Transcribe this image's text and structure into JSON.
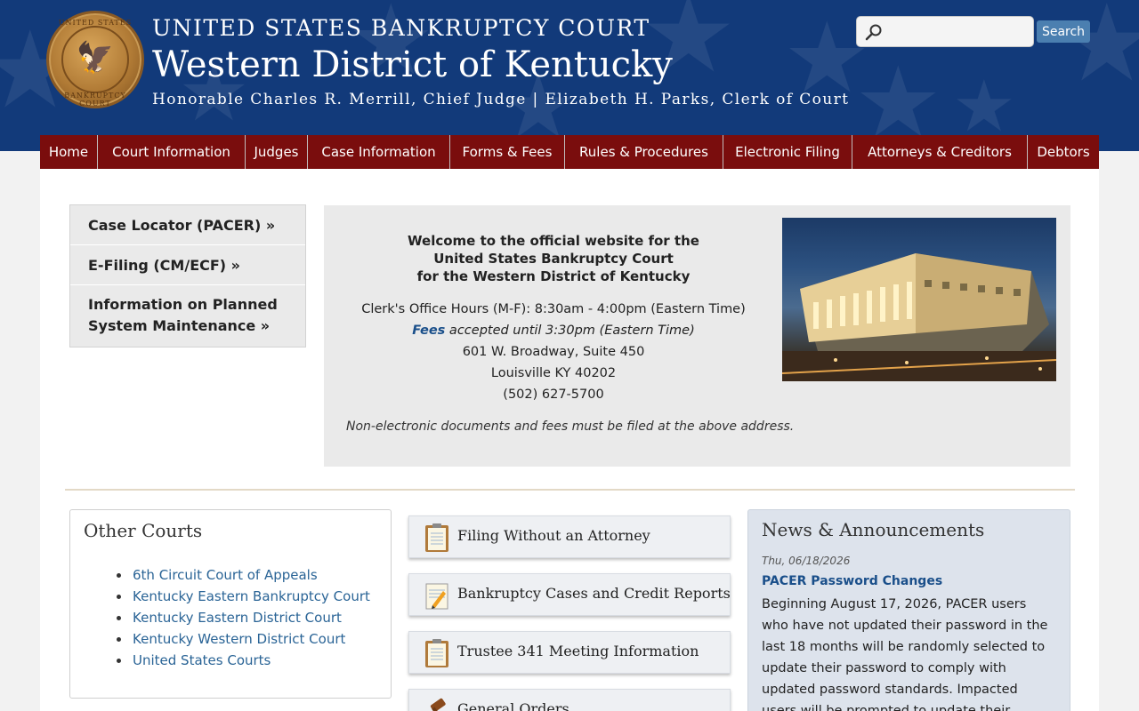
{
  "header": {
    "seal_text_top": "UNITED STATES",
    "seal_text_bottom": "BANKRUPTCY COURT",
    "court_name": "UNITED STATES BANKRUPTCY COURT",
    "district_name": "Western District of Kentucky",
    "officials": "Honorable Charles R. Merrill, Chief Judge | Elizabeth H. Parks, Clerk of Court",
    "search": {
      "placeholder": "",
      "value": "",
      "button_label": "Search"
    }
  },
  "nav": {
    "items": [
      {
        "label": "Home"
      },
      {
        "label": "Court Information"
      },
      {
        "label": "Judges"
      },
      {
        "label": "Case Information"
      },
      {
        "label": "Forms & Fees"
      },
      {
        "label": "Rules & Procedures"
      },
      {
        "label": "Electronic Filing"
      },
      {
        "label": "Attorneys & Creditors"
      },
      {
        "label": "Debtors"
      }
    ]
  },
  "quick_links": {
    "items": [
      {
        "label": "Case Locator (PACER) »"
      },
      {
        "label": "E-Filing (CM/ECF) »"
      },
      {
        "label_line1": "Information on Planned",
        "label_line2": "System Maintenance »"
      }
    ]
  },
  "welcome": {
    "title_lines": [
      "Welcome to the official website for the",
      "United States Bankruptcy Court",
      "for the Western District of Kentucky"
    ],
    "hours": "Clerk's Office Hours (M-F): 8:30am - 4:00pm (Eastern Time)",
    "fees_link": "Fees",
    "fees_rest": " accepted until 3:30pm (Eastern Time)",
    "address1": "601 W. Broadway, Suite 450",
    "address2": "Louisville KY 40202",
    "phone": "(502) 627-5700",
    "note": "Non-electronic documents and fees must be filed at the above address."
  },
  "other_courts": {
    "title": "Other Courts",
    "items": [
      {
        "label": "6th Circuit Court of Appeals"
      },
      {
        "label": "Kentucky Eastern Bankruptcy Court"
      },
      {
        "label": "Kentucky Eastern District Court"
      },
      {
        "label": "Kentucky Western District Court"
      },
      {
        "label": "United States Courts"
      }
    ]
  },
  "resources": {
    "items": [
      {
        "label": "Filing Without an Attorney",
        "icon": "clipboard-icon"
      },
      {
        "label": "Bankruptcy Cases and Credit Reports",
        "icon": "notepad-pencil-icon"
      },
      {
        "label": "Trustee 341 Meeting Information",
        "icon": "clipboard-icon"
      },
      {
        "label": "General Orders",
        "icon": "gavel-icon"
      }
    ]
  },
  "news": {
    "title": "News & Announcements",
    "date": "Thu, 06/18/2026",
    "headline": "PACER Password Changes",
    "body": "Beginning August 17, 2026, PACER users who have not updated their password in the last 18 months will be randomly selected to update their password to comply with updated password standards. Impacted users will be prompted to update their password."
  },
  "colors": {
    "header_blue": "#123a7a",
    "nav_maroon": "#7a0d0d",
    "link_blue": "#2a6496",
    "search_button": "#4b7fb0"
  }
}
